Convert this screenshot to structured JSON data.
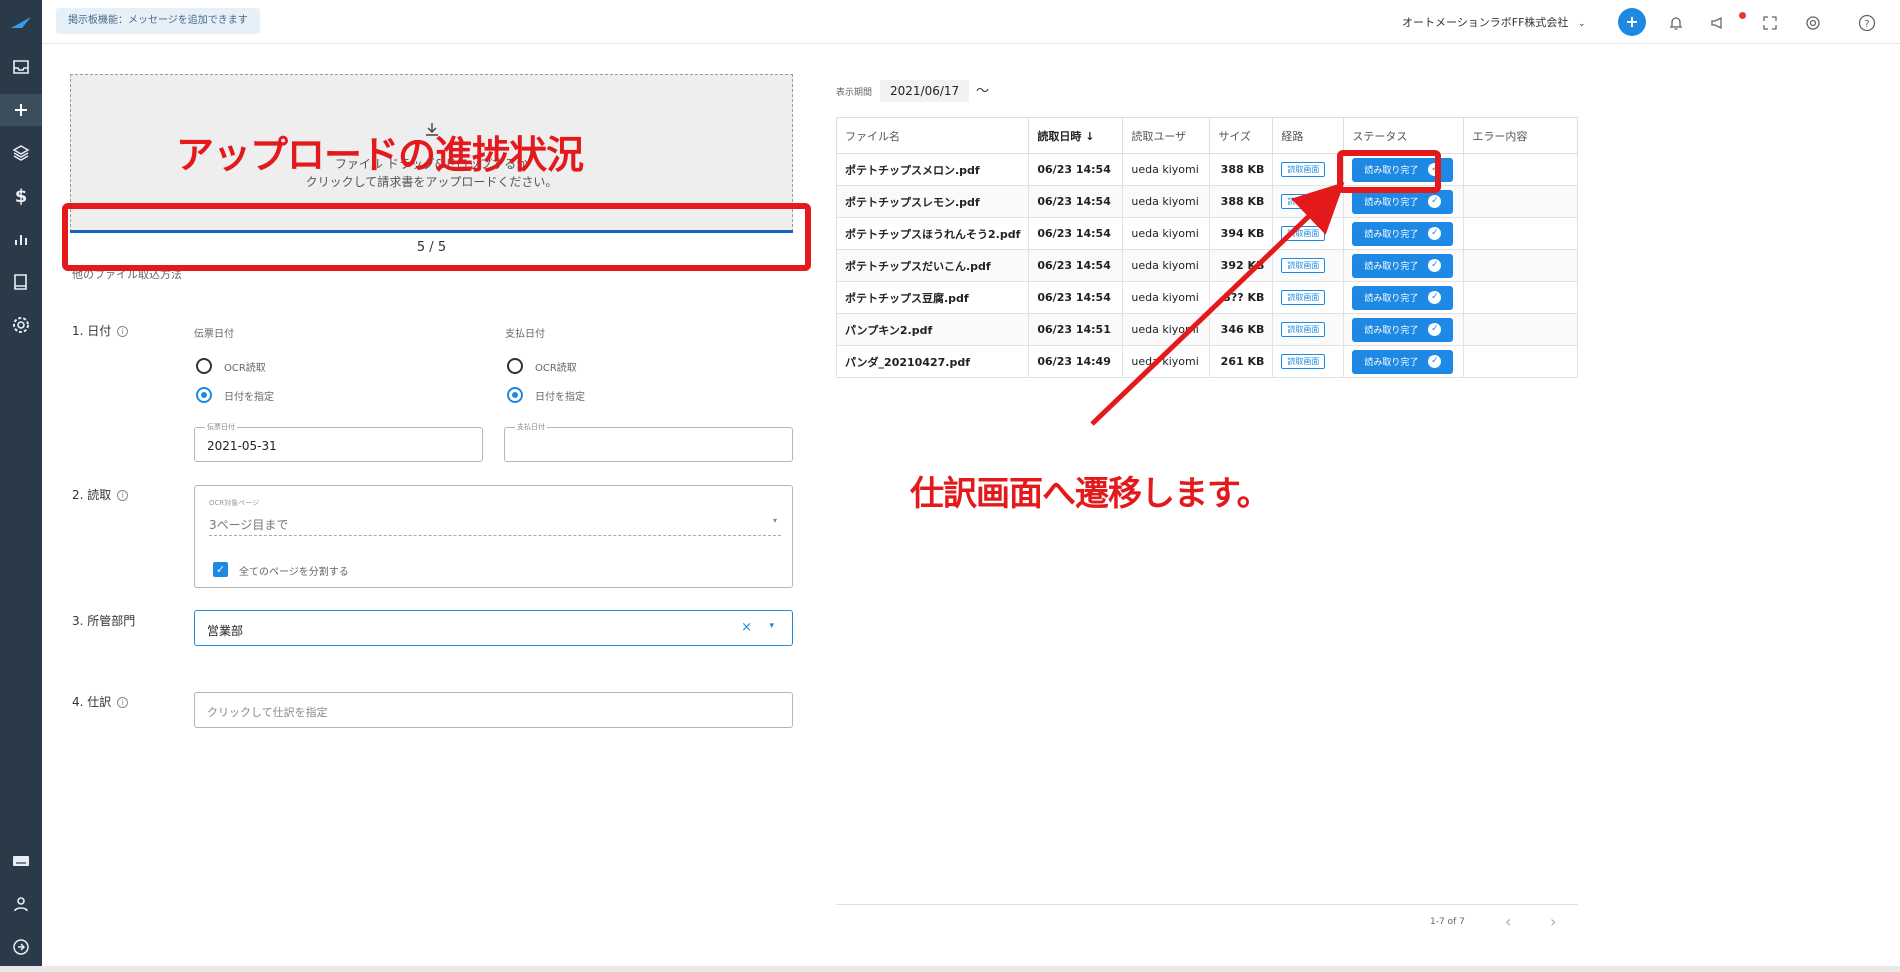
{
  "topbar": {
    "notice": "掲示板機能：メッセージを追加できます",
    "company": "オートメーションラボFF株式会社",
    "add_icon": "plus-icon",
    "bell_icon": "bell-icon",
    "megaphone_icon": "megaphone-icon",
    "fullscreen_icon": "fullscreen-icon",
    "support_icon": "support-icon",
    "help_icon": "help-icon"
  },
  "sidebar": {
    "items": [
      "logo-icon",
      "inbox-icon",
      "plus-icon",
      "layers-icon",
      "dollar-icon",
      "chart-icon",
      "book-icon",
      "gear-icon"
    ],
    "bottom_items": [
      "keyboard-icon",
      "user-icon",
      "logout-icon"
    ]
  },
  "upload": {
    "line1": "ファイル ドラッグ&ドロップするか",
    "line2": "クリックして請求書をアップロードください。",
    "progress": "5 / 5",
    "progress_fraction": 1.0,
    "partial_label": "他のファイル取込方法"
  },
  "annotations": {
    "upload_progress": "アップロードの進捗状況",
    "go_to_journal": "仕訳画面へ遷移します。"
  },
  "form": {
    "date_label": "1. 日付",
    "voucher_date_label": "伝票日付",
    "payment_date_label": "支払日付",
    "ocr_read": "OCR読取",
    "specify_date": "日付を指定",
    "voucher_date_field_label": "伝票日付",
    "voucher_date_value": "2021-05-31",
    "payment_date_field_label": "支払日付",
    "payment_date_value": "",
    "read_label": "2. 読取",
    "ocr_pages_label": "OCR対象ページ",
    "ocr_pages_value": "3ページ目まで",
    "split_pages": "全てのページを分割する",
    "dept_label": "3. 所管部門",
    "dept_value": "営業部",
    "journal_label": "4. 仕訳",
    "journal_placeholder": "クリックして仕訳を指定"
  },
  "list": {
    "period_label": "表示期間",
    "period_value": "2021/06/17",
    "tilde": "〜",
    "columns": [
      "ファイル名",
      "読取日時",
      "読取ユーザ",
      "サイズ",
      "経路",
      "ステータス",
      "エラー内容"
    ],
    "rows": [
      {
        "name": "ポテトチップスメロン.pdf",
        "time": "06/23 14:54",
        "user": "ueda kiyomi",
        "size": "388 KB",
        "route": "読取画面",
        "status": "読み取り完了"
      },
      {
        "name": "ポテトチップスレモン.pdf",
        "time": "06/23 14:54",
        "user": "ueda kiyomi",
        "size": "388 KB",
        "route": "読取画面",
        "status": "読み取り完了"
      },
      {
        "name": "ポテトチップスほうれんそう2.pdf",
        "time": "06/23 14:54",
        "user": "ueda kiyomi",
        "size": "394 KB",
        "route": "読取画面",
        "status": "読み取り完了"
      },
      {
        "name": "ポテトチップスだいこん.pdf",
        "time": "06/23 14:54",
        "user": "ueda kiyomi",
        "size": "392 KB",
        "route": "読取画面",
        "status": "読み取り完了"
      },
      {
        "name": "ポテトチップス豆腐.pdf",
        "time": "06/23 14:54",
        "user": "ueda kiyomi",
        "size": "3?? KB",
        "route": "読取画面",
        "status": "読み取り完了"
      },
      {
        "name": "パンプキン2.pdf",
        "time": "06/23 14:51",
        "user": "ueda kiyomi",
        "size": "346 KB",
        "route": "読取画面",
        "status": "読み取り完了"
      },
      {
        "name": "パンダ_20210427.pdf",
        "time": "06/23 14:49",
        "user": "ueda kiyomi",
        "size": "261 KB",
        "route": "読取画面",
        "status": "読み取り完了"
      }
    ],
    "pager": "1-7 of 7"
  },
  "colors": {
    "accent": "#1e88e5",
    "annotation": "#e3191c",
    "sidebar": "#2b3a48"
  }
}
